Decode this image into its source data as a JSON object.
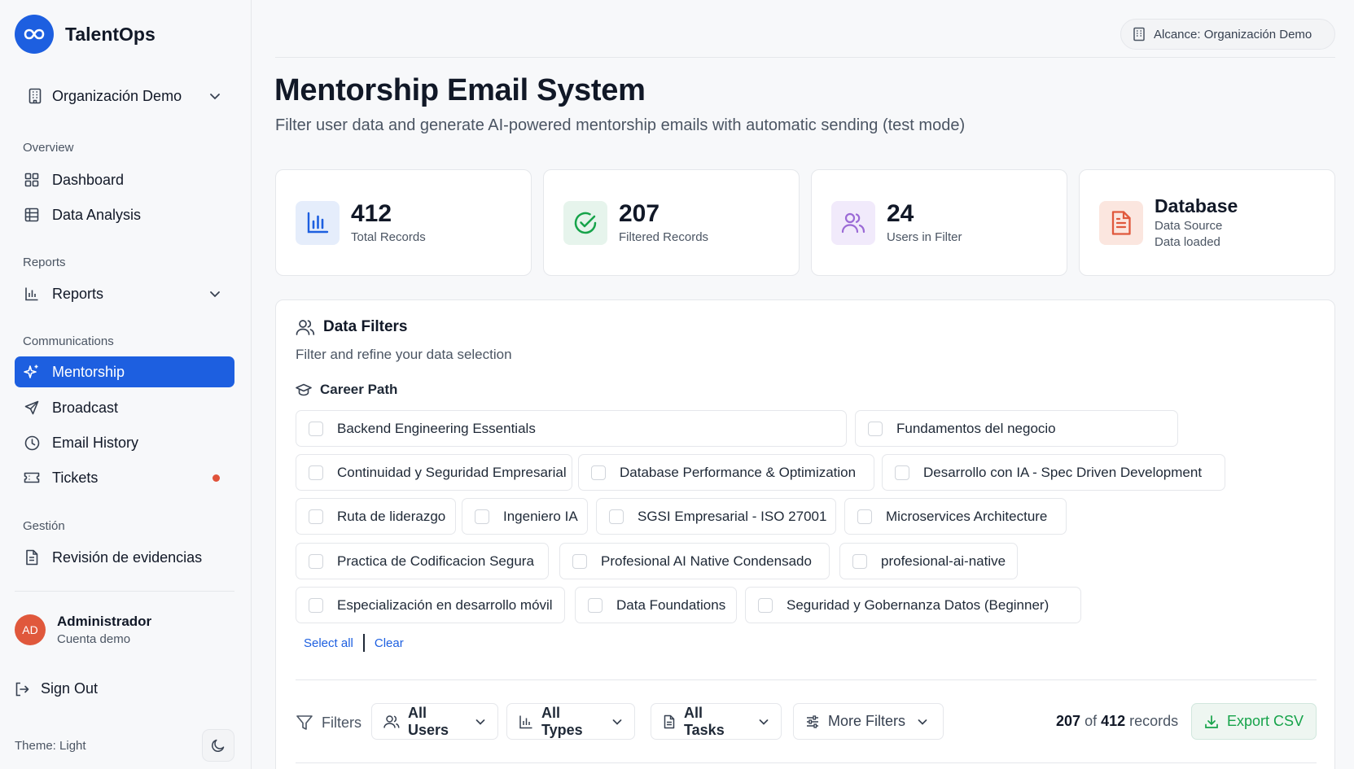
{
  "app": {
    "name": "TalentOps",
    "brand_color": "#1d5fe0"
  },
  "sidebar": {
    "org_selector": {
      "label": "Organización Demo"
    },
    "sections": {
      "overview": "Overview",
      "reports": "Reports",
      "communications": "Communications",
      "gestion": "Gestión"
    },
    "items": {
      "dashboard": "Dashboard",
      "data_analysis": "Data Analysis",
      "reports": "Reports",
      "mentorship": "Mentorship",
      "broadcast": "Broadcast",
      "email_history": "Email History",
      "tickets": "Tickets",
      "evidence_review": "Revisión de evidencias"
    },
    "user": {
      "initials": "AD",
      "name": "Administrador",
      "subtitle": "Cuenta demo"
    },
    "sign_out": "Sign Out",
    "theme_label": "Theme: Light"
  },
  "header": {
    "scope": "Alcance: Organización Demo"
  },
  "page": {
    "title": "Mentorship Email System",
    "subtitle": "Filter user data and generate AI-powered mentorship emails with automatic sending (test mode)"
  },
  "stats": {
    "total": {
      "value": "412",
      "label": "Total Records",
      "icon": "bar-chart-icon",
      "color": "#1d5fe0"
    },
    "filtered": {
      "value": "207",
      "label": "Filtered Records",
      "icon": "check-circle-icon",
      "color": "#16a34a"
    },
    "users": {
      "value": "24",
      "label": "Users in Filter",
      "icon": "users-icon",
      "color": "#9b6ad6"
    },
    "source": {
      "value": "Database",
      "label": "Data Source",
      "label2": "Data loaded",
      "icon": "file-icon",
      "color": "#e0583c"
    }
  },
  "filters": {
    "title": "Data Filters",
    "subtitle": "Filter and refine your data selection",
    "career_path_label": "Career Path",
    "career_paths": [
      "Backend Engineering Essentials",
      "Fundamentos del negocio",
      "Continuidad y Seguridad Empresarial",
      "Database Performance & Optimization",
      "Desarrollo con IA - Spec Driven Development",
      "Ruta de liderazgo",
      "Ingeniero IA",
      "SGSI Empresarial - ISO 27001",
      "Microservices Architecture",
      "Practica de Codificacion Segura",
      "Profesional AI Native Condensado",
      "profesional-ai-native",
      "Especialización en desarrollo móvil",
      "Data Foundations",
      "Seguridad y Gobernanza Datos (Beginner)"
    ],
    "select_all": "Select all",
    "clear": "Clear"
  },
  "filter_bar": {
    "label": "Filters",
    "users": "All Users",
    "types": "All Types",
    "tasks": "All Tasks",
    "more": "More Filters",
    "shown": "207",
    "of": "of",
    "total": "412",
    "records": "records",
    "export": "Export CSV"
  }
}
